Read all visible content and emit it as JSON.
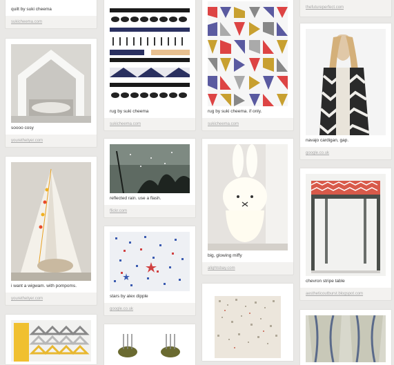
{
  "columns": [
    {
      "pins": [
        {
          "caption": "quilt by suki cheema",
          "source": "sukicheema.com"
        },
        {
          "caption": "soooo cosy",
          "source": "yourethetyer.com"
        },
        {
          "caption": "i want a wigwam. with pompoms.",
          "source": "yourethetyer.com"
        },
        {
          "caption": "",
          "source": ""
        }
      ]
    },
    {
      "pins": [
        {
          "caption": "rug by suki cheema",
          "source": "sukicheema.com"
        },
        {
          "caption": "reflected rain. use a flash.",
          "source": "flickr.com"
        },
        {
          "caption": "stars by alex dipple",
          "source": "google.co.uk"
        },
        {
          "caption": "",
          "source": ""
        }
      ]
    },
    {
      "pins": [
        {
          "caption": "rug by suki cheema. if only.",
          "source": "sukicheema.com"
        },
        {
          "caption": "big, glowing miffy",
          "source": "alightsbay.com"
        },
        {
          "caption": "",
          "source": ""
        }
      ]
    },
    {
      "pins": [
        {
          "caption": "",
          "source": "thefutureperfect.com"
        },
        {
          "caption": "navajo cardigan, gap.",
          "source": "google.co.uk"
        },
        {
          "caption": "chevron stripe table",
          "source": "aestheticoutburst.blogspot.com"
        },
        {
          "caption": "",
          "source": ""
        }
      ]
    }
  ]
}
